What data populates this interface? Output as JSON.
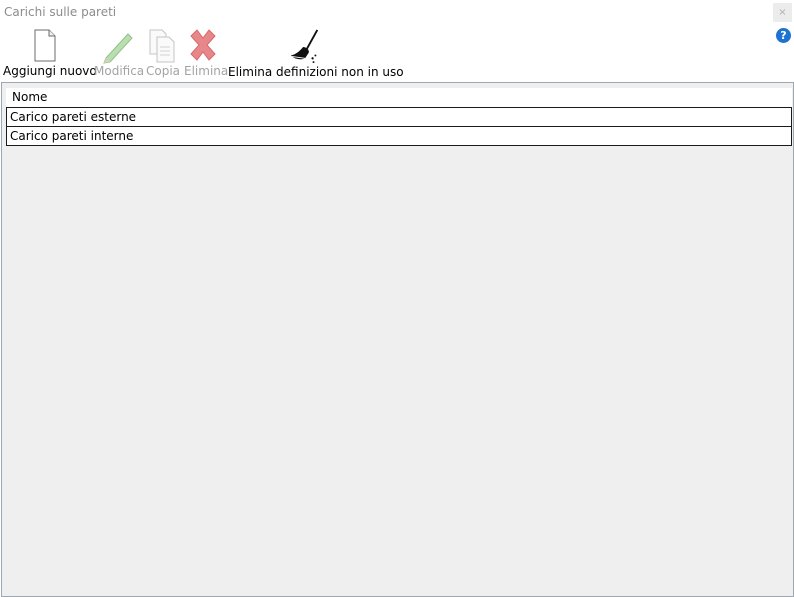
{
  "window": {
    "title": "Carichi sulle pareti",
    "close_label": "×",
    "help_label": "?"
  },
  "toolbar": {
    "add": {
      "label": "Aggiungi nuovo",
      "icon": "new-document-icon",
      "enabled": true
    },
    "edit": {
      "label": "Modifica",
      "icon": "pencil-icon",
      "enabled": false
    },
    "copy": {
      "label": "Copia",
      "icon": "copy-icon",
      "enabled": false
    },
    "delete": {
      "label": "Elimina",
      "icon": "delete-x-icon",
      "enabled": false
    },
    "purge": {
      "label": "Elimina definizioni non in uso",
      "icon": "broom-icon",
      "enabled": true
    }
  },
  "table": {
    "column_header": "Nome",
    "rows": [
      "Carico pareti esterne",
      "Carico pareti interne"
    ]
  },
  "colors": {
    "accent": "#1e73d2",
    "disabled_text": "#a3a3a3",
    "grid_bg": "#efefef",
    "delete_red": "#e06a6a"
  }
}
